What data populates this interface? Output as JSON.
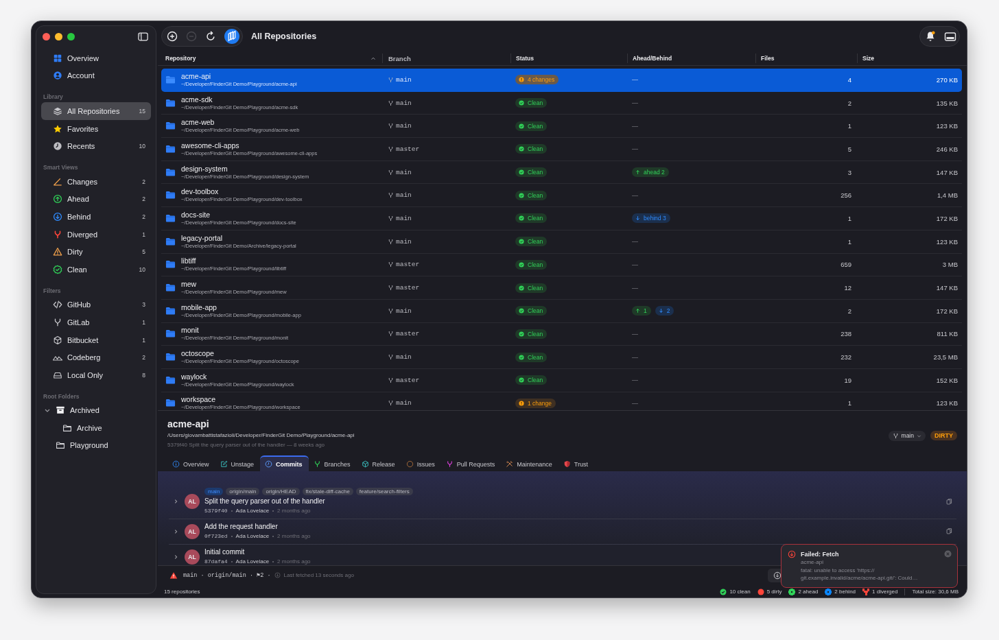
{
  "window": {
    "title": "All Repositories"
  },
  "toolbar_buttons": [
    {
      "disabled": false
    },
    {
      "disabled": true
    },
    {
      "disabled": false
    },
    {
      "disabled": false
    }
  ],
  "notifications": {
    "unread": true
  },
  "sidebar": {
    "sections": [
      {
        "items": [
          {
            "label": "Overview",
            "selected": false
          },
          {
            "label": "Account",
            "selected": false
          }
        ]
      },
      {
        "heading": "Library",
        "items": [
          {
            "label": "All Repositories",
            "count": "15",
            "selected": true
          },
          {
            "label": "Favorites",
            "selected": false
          },
          {
            "label": "Recents",
            "count": "10",
            "selected": false
          }
        ]
      },
      {
        "heading": "Smart Views",
        "items": [
          {
            "label": "Changes",
            "count": "2",
            "selected": false
          },
          {
            "label": "Ahead",
            "count": "2",
            "selected": false
          },
          {
            "label": "Behind",
            "count": "2",
            "selected": false
          },
          {
            "label": "Diverged",
            "count": "1",
            "selected": false
          },
          {
            "label": "Dirty",
            "count": "5",
            "selected": false
          },
          {
            "label": "Clean",
            "count": "10",
            "selected": false
          }
        ]
      },
      {
        "heading": "Filters",
        "items": [
          {
            "label": "GitHub",
            "count": "3",
            "selected": false
          },
          {
            "label": "GitLab",
            "count": "1",
            "selected": false
          },
          {
            "label": "Bitbucket",
            "count": "1",
            "selected": false
          },
          {
            "label": "Codeberg",
            "count": "2",
            "selected": false
          },
          {
            "label": "Local Only",
            "count": "8",
            "selected": false
          }
        ]
      }
    ],
    "root_folders": {
      "heading": "Root Folders",
      "items": [
        {
          "label": "Archived",
          "expanded": true,
          "selected": false,
          "children": [
            {
              "label": "Archive",
              "selected": false
            }
          ]
        },
        {
          "label": "Playground",
          "selected": false
        }
      ]
    }
  },
  "table": {
    "columns": [
      {
        "label": "Repository",
        "sorted": true
      },
      {
        "label": "Branch",
        "sorted": false
      },
      {
        "label": "Status",
        "sorted": false
      },
      {
        "label": "Ahead/Behind",
        "sorted": false
      },
      {
        "label": "Files",
        "sorted": false
      },
      {
        "label": "Size",
        "sorted": false
      }
    ],
    "rows": [
      {
        "name": "acme-api",
        "path": "~/Developer/FinderGit Demo/Playground/acme-api",
        "branch": "main",
        "status": {
          "kind": "changes",
          "text": "4 changes"
        },
        "sync_text": "—",
        "files": "4",
        "size": "270 KB",
        "selected": true
      },
      {
        "name": "acme-sdk",
        "path": "~/Developer/FinderGit Demo/Playground/acme-sdk",
        "branch": "main",
        "status": {
          "kind": "clean",
          "text": "Clean"
        },
        "sync_text": "—",
        "files": "2",
        "size": "135 KB",
        "selected": false
      },
      {
        "name": "acme-web",
        "path": "~/Developer/FinderGit Demo/Playground/acme-web",
        "branch": "main",
        "status": {
          "kind": "clean",
          "text": "Clean"
        },
        "sync_text": "—",
        "files": "1",
        "size": "123 KB",
        "selected": false
      },
      {
        "name": "awesome-cli-apps",
        "path": "~/Developer/FinderGit Demo/Playground/awesome-cli-apps",
        "branch": "master",
        "status": {
          "kind": "clean",
          "text": "Clean"
        },
        "sync_text": "—",
        "files": "5",
        "size": "246 KB",
        "selected": false
      },
      {
        "name": "design-system",
        "path": "~/Developer/FinderGit Demo/Playground/design-system",
        "branch": "main",
        "status": {
          "kind": "clean",
          "text": "Clean"
        },
        "sync": [
          {
            "kind": "ahead",
            "text": "ahead 2"
          }
        ],
        "files": "3",
        "size": "147 KB",
        "selected": false
      },
      {
        "name": "dev-toolbox",
        "path": "~/Developer/FinderGit Demo/Playground/dev-toolbox",
        "branch": "main",
        "status": {
          "kind": "clean",
          "text": "Clean"
        },
        "sync_text": "—",
        "files": "256",
        "size": "1,4 MB",
        "selected": false
      },
      {
        "name": "docs-site",
        "path": "~/Developer/FinderGit Demo/Playground/docs-site",
        "branch": "main",
        "status": {
          "kind": "clean",
          "text": "Clean"
        },
        "sync": [
          {
            "kind": "behind",
            "text": "behind 3"
          }
        ],
        "files": "1",
        "size": "172 KB",
        "selected": false
      },
      {
        "name": "legacy-portal",
        "path": "~/Developer/FinderGit Demo/Archive/legacy-portal",
        "branch": "main",
        "status": {
          "kind": "clean",
          "text": "Clean"
        },
        "sync_text": "—",
        "files": "1",
        "size": "123 KB",
        "selected": false
      },
      {
        "name": "libtiff",
        "path": "~/Developer/FinderGit Demo/Playground/libtiff",
        "branch": "master",
        "status": {
          "kind": "clean",
          "text": "Clean"
        },
        "sync_text": "—",
        "files": "659",
        "size": "3 MB",
        "selected": false
      },
      {
        "name": "mew",
        "path": "~/Developer/FinderGit Demo/Playground/mew",
        "branch": "master",
        "status": {
          "kind": "clean",
          "text": "Clean"
        },
        "sync_text": "—",
        "files": "12",
        "size": "147 KB",
        "selected": false
      },
      {
        "name": "mobile-app",
        "path": "~/Developer/FinderGit Demo/Playground/mobile-app",
        "branch": "main",
        "status": {
          "kind": "clean",
          "text": "Clean"
        },
        "sync": [
          {
            "kind": "ahead",
            "text": "1"
          },
          {
            "kind": "behind",
            "text": "2"
          }
        ],
        "files": "2",
        "size": "172 KB",
        "selected": false
      },
      {
        "name": "monit",
        "path": "~/Developer/FinderGit Demo/Playground/monit",
        "branch": "master",
        "status": {
          "kind": "clean",
          "text": "Clean"
        },
        "sync_text": "—",
        "files": "238",
        "size": "811 KB",
        "selected": false
      },
      {
        "name": "octoscope",
        "path": "~/Developer/FinderGit Demo/Playground/octoscope",
        "branch": "main",
        "status": {
          "kind": "clean",
          "text": "Clean"
        },
        "sync_text": "—",
        "files": "232",
        "size": "23,5 MB",
        "selected": false
      },
      {
        "name": "waylock",
        "path": "~/Developer/FinderGit Demo/Playground/waylock",
        "branch": "master",
        "status": {
          "kind": "clean",
          "text": "Clean"
        },
        "sync_text": "—",
        "files": "19",
        "size": "152 KB",
        "selected": false
      },
      {
        "name": "workspace",
        "path": "~/Developer/FinderGit Demo/Playground/workspace",
        "branch": "main",
        "status": {
          "kind": "changes",
          "text": "1 change"
        },
        "sync_text": "—",
        "files": "1",
        "size": "123 KB",
        "selected": false
      }
    ]
  },
  "detail": {
    "title": "acme-api",
    "path": "/Users/giovambattistafazioli/Developer/FinderGit Demo/Playground/acme-api",
    "last_commit": "5379f40 Split the query parser out of the handler — 8 weeks ago",
    "branch": "main",
    "state": {
      "kind": "dirty",
      "text": "DIRTY"
    },
    "tabs": [
      {
        "label": "Overview",
        "selected": false
      },
      {
        "label": "Unstage",
        "selected": false
      },
      {
        "label": "Commits",
        "selected": true
      },
      {
        "label": "Branches",
        "selected": false
      },
      {
        "label": "Release",
        "selected": false
      },
      {
        "label": "Issues",
        "selected": false
      },
      {
        "label": "Pull Requests",
        "selected": false
      },
      {
        "label": "Maintenance",
        "selected": false
      },
      {
        "label": "Trust",
        "selected": false
      }
    ],
    "commits": [
      {
        "refs": [
          {
            "kind": "local",
            "text": "main"
          },
          {
            "kind": "remote",
            "text": "origin/main"
          },
          {
            "kind": "remote",
            "text": "origin/HEAD"
          },
          {
            "kind": "remote",
            "text": "fix/stale-diff-cache"
          },
          {
            "kind": "remote",
            "text": "feature/search-filters"
          }
        ],
        "initials": "AL",
        "message": "Split the query parser out of the handler",
        "hash": "5379f40",
        "author": "Ada Lovelace",
        "time": "2 months ago",
        "expanded": false
      },
      {
        "initials": "AL",
        "message": "Add the request handler",
        "hash": "0f723ed",
        "author": "Ada Lovelace",
        "time": "2 months ago",
        "expanded": false
      },
      {
        "initials": "AL",
        "message": "Initial commit",
        "hash": "87dafa4",
        "author": "Ada Lovelace",
        "time": "2 months ago",
        "expanded": false
      }
    ]
  },
  "status_line": {
    "refs": "main · origin/main · ⚑2 ·",
    "fetched": "Last fetched 13 seconds ago"
  },
  "footer": {
    "count": "15 repositories",
    "stats": [
      {
        "kind": "clean",
        "text": "10 clean",
        "color": "#30d158"
      },
      {
        "kind": "dirty",
        "text": "5 dirty",
        "color": "#ff453a"
      },
      {
        "kind": "ahead",
        "text": "2 ahead",
        "color": "#30d158"
      },
      {
        "kind": "behind",
        "text": "2 behind",
        "color": "#0a84ff"
      },
      {
        "kind": "diverged",
        "text": "1 diverged",
        "color": "#ff453a"
      }
    ],
    "total": "Total size: 30,6 MB"
  },
  "toast": {
    "title": "Failed: Fetch",
    "subtitle": "acme-api",
    "message": "fatal: unable to access 'https:// git.example.invalid/acme/acme-api.git/': Could…"
  }
}
